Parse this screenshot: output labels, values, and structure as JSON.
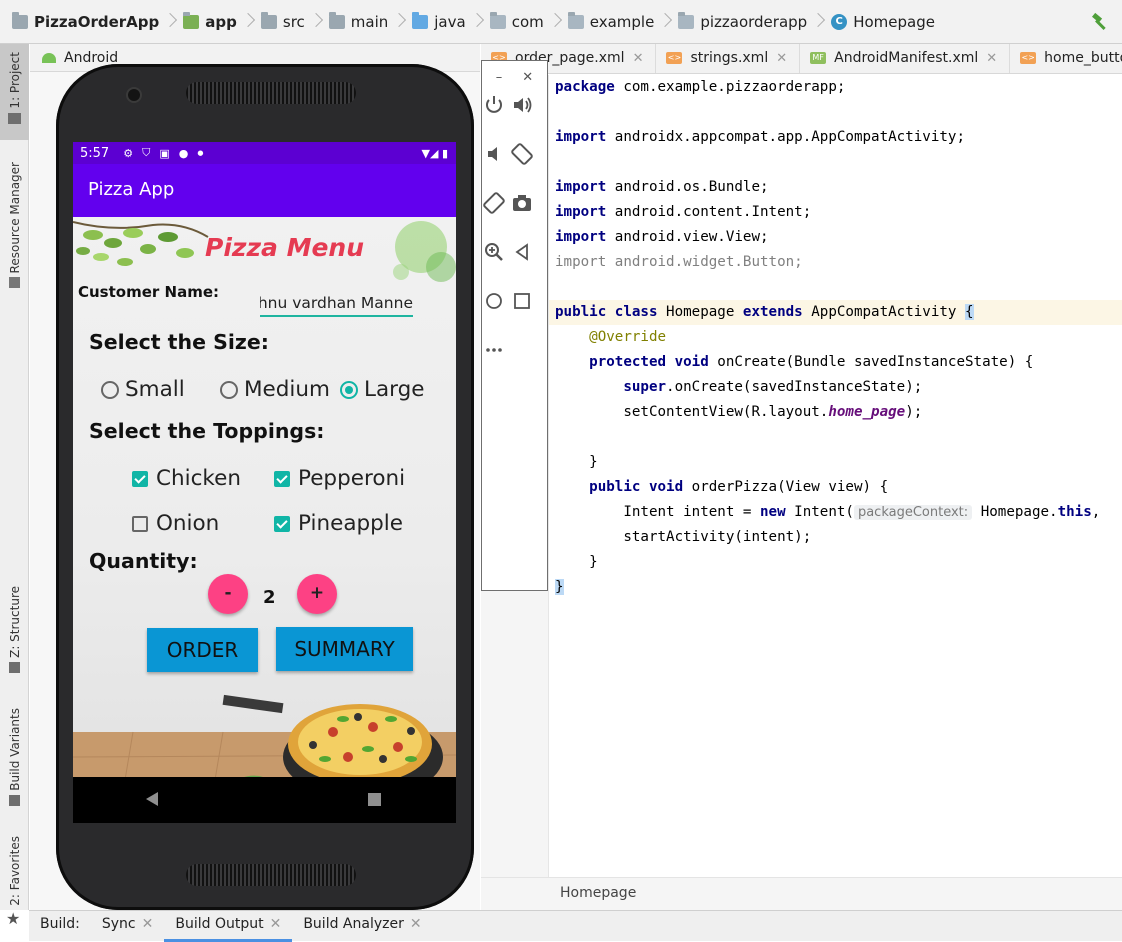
{
  "breadcrumb": {
    "items": [
      "PizzaOrderApp",
      "app",
      "src",
      "main",
      "java",
      "com",
      "example",
      "pizzaorderapp",
      "Homepage"
    ]
  },
  "left_strip": {
    "project": "1: Project",
    "resource_manager": "Resource Manager",
    "structure": "Z: Structure",
    "build_variants": "Build Variants",
    "favorites": "2: Favorites"
  },
  "project_panel": {
    "view_mode": "Android"
  },
  "editor": {
    "tabs": [
      "order_page.xml",
      "strings.xml",
      "AndroidManifest.xml",
      "home_button.xml"
    ],
    "breadcrumb": "Homepage",
    "lines": {
      "l1_kw": "package",
      "l1_rest": " com.example.pizzaorderapp;",
      "l3_kw": "import",
      "l3_rest": " androidx.appcompat.app.AppCompatActivity;",
      "l5_kw": "import",
      "l5_rest": " android.os.Bundle;",
      "l6_kw": "import",
      "l6_rest": " android.content.Intent;",
      "l7_kw": "import",
      "l7_rest": " android.view.View;",
      "l8_kw": "import",
      "l8_rest": " android.widget.Button;",
      "l10_kw1": "public class",
      "l10_mid": " Homepage ",
      "l10_kw2": "extends",
      "l10_rest": " AppCompatActivity ",
      "l10_brace": "{",
      "l11": "    @Override",
      "l12_kw": "    protected void",
      "l12_rest": " onCreate(Bundle savedInstanceState) {",
      "l13_kw": "        super",
      "l13_rest": ".onCreate(savedInstanceState);",
      "l14_pre": "        setContentView(R.layout.",
      "l14_it": "home_page",
      "l14_post": ");",
      "l16": "    }",
      "l17_kw": "    public void",
      "l17_rest": " orderPizza(View view) {",
      "l18_pre": "        Intent ",
      "l18_var": "intent",
      "l18_mid": " = ",
      "l18_kw": "new",
      "l18_call": " Intent(",
      "l18_hint": "packageContext:",
      "l18_post": " Homepage.",
      "l18_kw2": "this",
      "l18_end": ",",
      "l19": "        startActivity(intent);",
      "l20": "    }",
      "l21": "}"
    }
  },
  "bottom_bar": {
    "label": "Build:",
    "tabs": [
      "Sync",
      "Build Output",
      "Build Analyzer"
    ],
    "active": "Build Output"
  },
  "phone": {
    "status_time": "5:57",
    "app_title": "Pizza App",
    "menu_title": "Pizza Menu",
    "customer_label": "Customer Name:",
    "customer_value": "ishnu vardhan Manne",
    "size_heading": "Select the Size:",
    "sizes": [
      {
        "label": "Small",
        "selected": false
      },
      {
        "label": "Medium",
        "selected": false
      },
      {
        "label": "Large",
        "selected": true
      }
    ],
    "toppings_heading": "Select the Toppings:",
    "toppings": [
      {
        "label": "Chicken",
        "checked": true
      },
      {
        "label": "Pepperoni",
        "checked": true
      },
      {
        "label": "Onion",
        "checked": false
      },
      {
        "label": "Pineapple",
        "checked": true
      }
    ],
    "quantity_heading": "Quantity:",
    "minus_label": "-",
    "plus_label": "+",
    "quantity": "2",
    "order_label": "ORDER",
    "summary_label": "SUMMARY"
  },
  "colors": {
    "status_bar": "#5c00d2",
    "app_bar": "#6200ee",
    "accent": "#10b5a6",
    "fab": "#fd4184",
    "button": "#0a96d4",
    "menu_title": "#e53b52"
  }
}
